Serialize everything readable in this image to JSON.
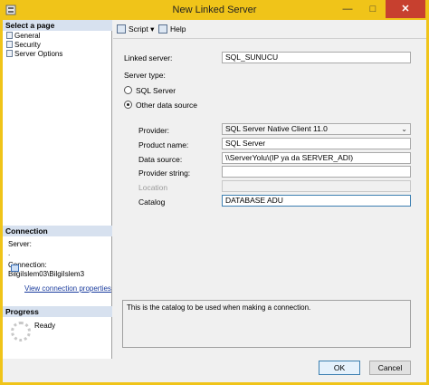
{
  "window": {
    "title": "New Linked Server",
    "minimize_glyph": "—",
    "maximize_glyph": "□",
    "close_glyph": "✕"
  },
  "left_panel": {
    "select_page_header": "Select a page",
    "pages": [
      "General",
      "Security",
      "Server Options"
    ],
    "connection_header": "Connection",
    "server_label": "Server:",
    "server_value": ".",
    "connection_label": "Connection:",
    "connection_value": "BilgiIslem03\\BilgiIslem3",
    "view_connection_properties": "View connection properties",
    "progress_header": "Progress",
    "progress_status": "Ready"
  },
  "toolbar": {
    "script_label": "Script",
    "script_dropdown_glyph": "▾",
    "help_label": "Help"
  },
  "form": {
    "linked_server_label": "Linked server:",
    "linked_server_value": "SQL_SUNUCU",
    "server_type_label": "Server type:",
    "sql_server_option": "SQL Server",
    "other_data_source_option": "Other data source",
    "provider_label": "Provider:",
    "provider_value": "SQL Server Native Client 11.0",
    "product_name_label": "Product name:",
    "product_name_value": "SQL Server",
    "data_source_label": "Data source:",
    "data_source_value": "\\\\ServerYolu\\(IP ya da SERVER_ADI)",
    "provider_string_label": "Provider string:",
    "provider_string_value": "",
    "location_label": "Location",
    "location_value": "",
    "catalog_label": "Catalog",
    "catalog_value": "DATABASE ADU",
    "description": "This is the catalog to be used when making a connection."
  },
  "buttons": {
    "ok": "OK",
    "cancel": "Cancel"
  }
}
